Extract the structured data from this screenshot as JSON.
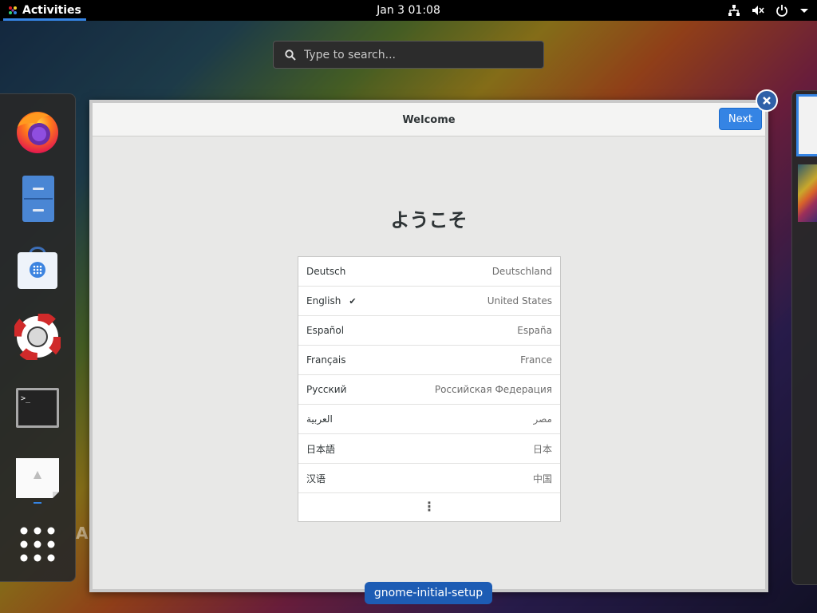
{
  "topbar": {
    "activities_label": "Activities",
    "clock": "Jan 3  01:08",
    "icons": [
      "network-wired-icon",
      "volume-muted-icon",
      "power-icon",
      "dropdown-arrow-icon"
    ]
  },
  "search": {
    "placeholder": "Type to search..."
  },
  "dash": {
    "apps": [
      "firefox-icon",
      "files-icon",
      "software-icon",
      "help-icon",
      "terminal-icon",
      "image-viewer-icon",
      "show-apps-icon"
    ]
  },
  "window": {
    "title": "Welcome",
    "next_label": "Next",
    "heading": "ようこそ",
    "languages": [
      {
        "name": "Deutsch",
        "country": "Deutschland",
        "selected": false
      },
      {
        "name": "English",
        "country": "United States",
        "selected": true,
        "check": "✔"
      },
      {
        "name": "Español",
        "country": "España",
        "selected": false
      },
      {
        "name": "Français",
        "country": "France",
        "selected": false
      },
      {
        "name": "Русский",
        "country": "Российская Федерация",
        "selected": false
      },
      {
        "name": "العربية",
        "country": "مصر",
        "selected": false
      },
      {
        "name": "日本語",
        "country": "日本",
        "selected": false
      },
      {
        "name": "汉语",
        "country": "中国",
        "selected": false
      }
    ],
    "more_label": "⋮"
  },
  "app_label": "gnome-initial-setup",
  "ghost_text": "Al",
  "colors": {
    "accent": "#3584e4",
    "topbar": "#000000",
    "app_label_bg": "#1d5cb4"
  }
}
